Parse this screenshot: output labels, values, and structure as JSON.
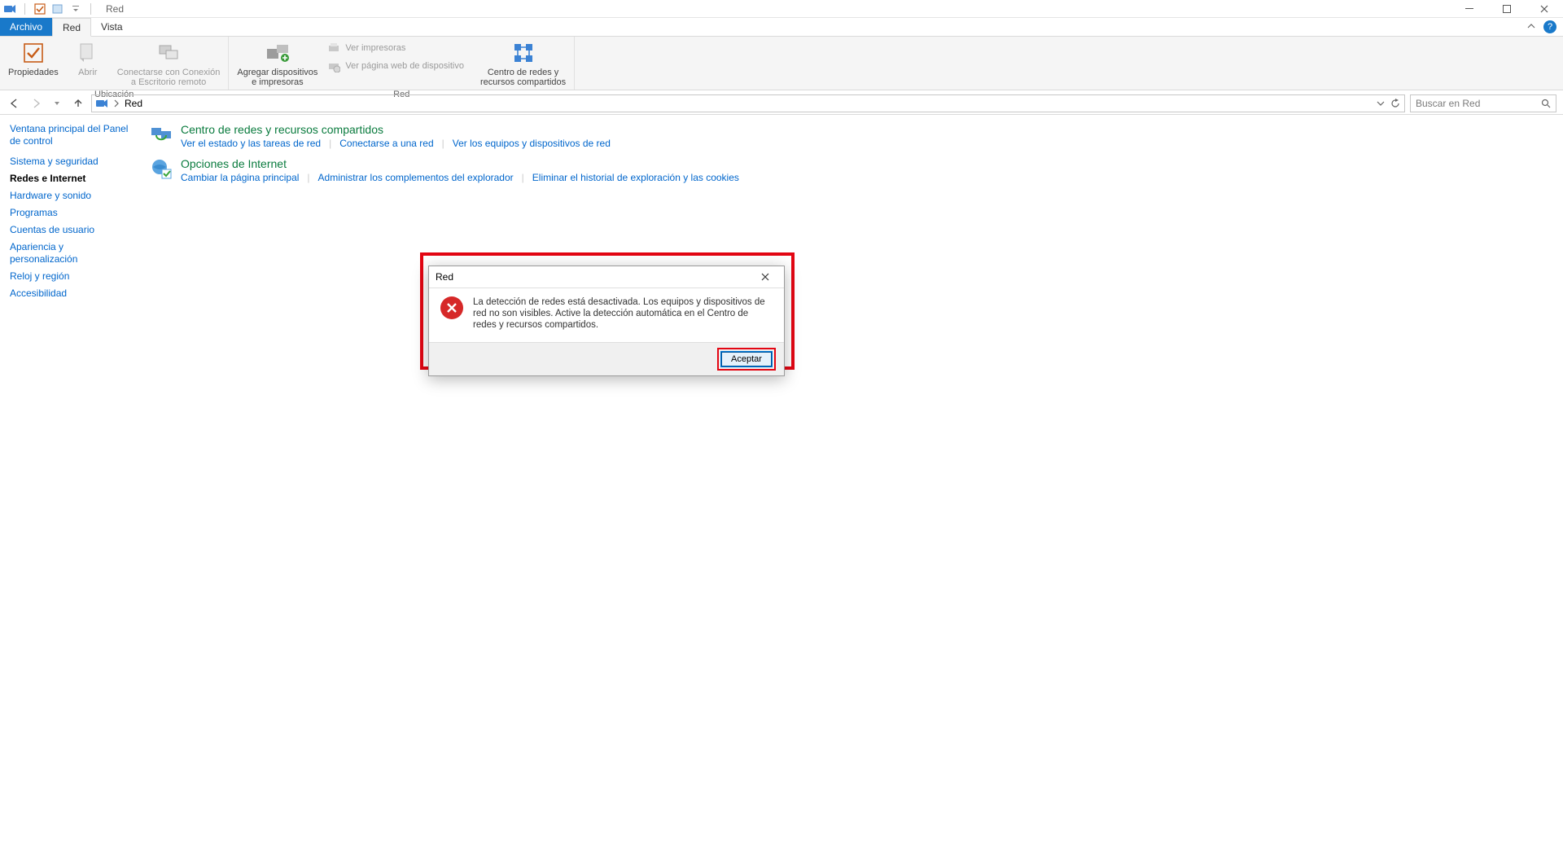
{
  "window": {
    "title": "Red"
  },
  "tabs": {
    "file": "Archivo",
    "network": "Red",
    "view": "Vista"
  },
  "ribbon": {
    "location_group": "Ubicación",
    "network_group": "Red",
    "properties": "Propiedades",
    "open": "Abrir",
    "connect_rdp_l1": "Conectarse con Conexión",
    "connect_rdp_l2": "a Escritorio remoto",
    "add_devices_l1": "Agregar dispositivos",
    "add_devices_l2": "e impresoras",
    "view_printers": "Ver impresoras",
    "view_device_web": "Ver página web de dispositivo",
    "network_center_l1": "Centro de redes y",
    "network_center_l2": "recursos compartidos"
  },
  "nav": {
    "location": "Red",
    "search_placeholder": "Buscar en Red"
  },
  "sidebar": {
    "heading": "Ventana principal del Panel de control",
    "items": [
      "Sistema y seguridad",
      "Redes e Internet",
      "Hardware y sonido",
      "Programas",
      "Cuentas de usuario",
      "Apariencia y personalización",
      "Reloj y región",
      "Accesibilidad"
    ],
    "current_index": 1
  },
  "categories": [
    {
      "title": "Centro de redes y recursos compartidos",
      "links": [
        "Ver el estado y las tareas de red",
        "Conectarse a una red",
        "Ver los equipos y dispositivos de red"
      ]
    },
    {
      "title": "Opciones de Internet",
      "links": [
        "Cambiar la página principal",
        "Administrar los complementos del explorador",
        "Eliminar el historial de exploración y las cookies"
      ]
    }
  ],
  "dialog": {
    "title": "Red",
    "message": "La detección de redes está desactivada. Los equipos y dispositivos de red no son visibles. Active la detección automática en el Centro de redes y recursos compartidos.",
    "accept": "Aceptar"
  }
}
